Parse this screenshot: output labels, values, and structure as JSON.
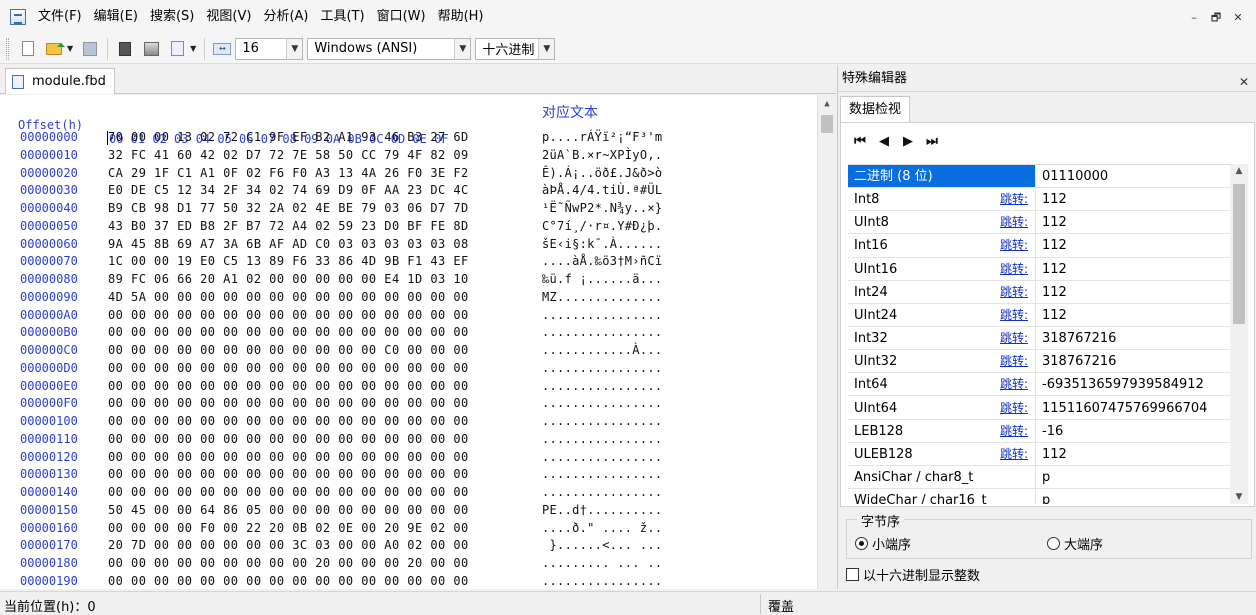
{
  "menu": [
    "文件(F)",
    "编辑(E)",
    "搜索(S)",
    "视图(V)",
    "分析(A)",
    "工具(T)",
    "窗口(W)",
    "帮助(H)"
  ],
  "window_controls": [
    "–",
    "🗗",
    "✕"
  ],
  "toolbar": {
    "bytes_per_row": "16",
    "encoding": "Windows (ANSI)",
    "offset_base": "十六进制"
  },
  "document_tab": "module.fbd",
  "hex": {
    "header_offset": "Offset(h)",
    "header_bytes": "00 01 02 03 04 05 06 07 08 09 0A 0B 0C 0D 0E 0F",
    "header_text": "对应文本",
    "rows": [
      {
        "off": "00000000",
        "hex": "70 00 00 13 02 72 C1 9F EF B2 A1 93 46 B3 27 6D",
        "asc": "p....rÁŸï²¡“F³'m"
      },
      {
        "off": "00000010",
        "hex": "32 FC 41 60 42 02 D7 72 7E 58 50 CC 79 4F 82 09",
        "asc": "2üA`B.×r~XPÌyO‚."
      },
      {
        "off": "00000020",
        "hex": "CA 29 1F C1 A1 0F 02 F6 F0 A3 13 4A 26 F0 3E F2",
        "asc": "Ê).Á¡..öð£.J&ð>ò"
      },
      {
        "off": "00000030",
        "hex": "E0 DE C5 12 34 2F 34 02 74 69 D9 0F AA 23 DC 4C",
        "asc": "àÞÅ.4/4.tiÙ.ª#ÜL"
      },
      {
        "off": "00000040",
        "hex": "B9 CB 98 D1 77 50 32 2A 02 4E BE 79 03 06 D7 7D",
        "asc": "¹Ë˜ÑwP2*.N¾y..×}"
      },
      {
        "off": "00000050",
        "hex": "43 B0 37 ED B8 2F B7 72 A4 02 59 23 D0 BF FE 8D",
        "asc": "C°7í¸/·r¤.Y#Ð¿þ."
      },
      {
        "off": "00000060",
        "hex": "9A 45 8B 69 A7 3A 6B AF AD C0 03 03 03 03 03 08",
        "asc": "šE‹i§:k¯.À......"
      },
      {
        "off": "00000070",
        "hex": "1C 00 00 19 E0 C5 13 89 F6 33 86 4D 9B F1 43 EF",
        "asc": "....àÅ.‰ö3†M›ñCï"
      },
      {
        "off": "00000080",
        "hex": "89 FC 06 66 20 A1 02 00 00 00 00 00 E4 1D 03 10",
        "asc": "‰ü.f ¡......ä..."
      },
      {
        "off": "00000090",
        "hex": "4D 5A 00 00 00 00 00 00 00 00 00 00 00 00 00 00",
        "asc": "MZ.............."
      },
      {
        "off": "000000A0",
        "hex": "00 00 00 00 00 00 00 00 00 00 00 00 00 00 00 00",
        "asc": "................"
      },
      {
        "off": "000000B0",
        "hex": "00 00 00 00 00 00 00 00 00 00 00 00 00 00 00 00",
        "asc": "................"
      },
      {
        "off": "000000C0",
        "hex": "00 00 00 00 00 00 00 00 00 00 00 00 C0 00 00 00",
        "asc": "............À..."
      },
      {
        "off": "000000D0",
        "hex": "00 00 00 00 00 00 00 00 00 00 00 00 00 00 00 00",
        "asc": "................"
      },
      {
        "off": "000000E0",
        "hex": "00 00 00 00 00 00 00 00 00 00 00 00 00 00 00 00",
        "asc": "................"
      },
      {
        "off": "000000F0",
        "hex": "00 00 00 00 00 00 00 00 00 00 00 00 00 00 00 00",
        "asc": "................"
      },
      {
        "off": "00000100",
        "hex": "00 00 00 00 00 00 00 00 00 00 00 00 00 00 00 00",
        "asc": "................"
      },
      {
        "off": "00000110",
        "hex": "00 00 00 00 00 00 00 00 00 00 00 00 00 00 00 00",
        "asc": "................"
      },
      {
        "off": "00000120",
        "hex": "00 00 00 00 00 00 00 00 00 00 00 00 00 00 00 00",
        "asc": "................"
      },
      {
        "off": "00000130",
        "hex": "00 00 00 00 00 00 00 00 00 00 00 00 00 00 00 00",
        "asc": "................"
      },
      {
        "off": "00000140",
        "hex": "00 00 00 00 00 00 00 00 00 00 00 00 00 00 00 00",
        "asc": "................"
      },
      {
        "off": "00000150",
        "hex": "50 45 00 00 64 86 05 00 00 00 00 00 00 00 00 00",
        "asc": "PE..d†.........."
      },
      {
        "off": "00000160",
        "hex": "00 00 00 00 F0 00 22 20 0B 02 0E 00 20 9E 02 00",
        "asc": "....ð.\" .... ž.."
      },
      {
        "off": "00000170",
        "hex": "20 7D 00 00 00 00 00 00 3C 03 00 00 A0 02 00 00",
        "asc": " }......<... ..."
      },
      {
        "off": "00000180",
        "hex": "00 00 00 00 00 00 00 00 00 20 00 00 00 20 00 00",
        "asc": "......... ... .."
      },
      {
        "off": "00000190",
        "hex": "00 00 00 00 00 00 00 00 00 00 00 00 00 00 00 00",
        "asc": "................"
      }
    ]
  },
  "panel": {
    "title": "特殊编辑器",
    "close": "✕",
    "tab": "数据检视",
    "nav": [
      "⏮",
      "◀",
      "▶",
      "⏭"
    ],
    "jump_label": "跳转:",
    "rows": [
      {
        "name": "二进制 (8 位)",
        "value": "01110000",
        "link": false,
        "selected": true
      },
      {
        "name": "Int8",
        "value": "112",
        "link": true
      },
      {
        "name": "UInt8",
        "value": "112",
        "link": true
      },
      {
        "name": "Int16",
        "value": "112",
        "link": true
      },
      {
        "name": "UInt16",
        "value": "112",
        "link": true
      },
      {
        "name": "Int24",
        "value": "112",
        "link": true
      },
      {
        "name": "UInt24",
        "value": "112",
        "link": true
      },
      {
        "name": "Int32",
        "value": "318767216",
        "link": true
      },
      {
        "name": "UInt32",
        "value": "318767216",
        "link": true
      },
      {
        "name": "Int64",
        "value": "-6935136597939584912",
        "link": true
      },
      {
        "name": "UInt64",
        "value": "11511607475769966704",
        "link": true
      },
      {
        "name": "LEB128",
        "value": "-16",
        "link": true
      },
      {
        "name": "ULEB128",
        "value": "112",
        "link": true
      },
      {
        "name": "AnsiChar / char8_t",
        "value": "p",
        "link": false
      },
      {
        "name": "WideChar / char16_t",
        "value": "p",
        "link": false
      }
    ],
    "byte_order": {
      "legend": "字节序",
      "little": "小端序",
      "big": "大端序"
    },
    "hex_int_label": "以十六进制显示整数"
  },
  "status": {
    "position": "当前位置(h)：0",
    "mode": "覆盖"
  }
}
